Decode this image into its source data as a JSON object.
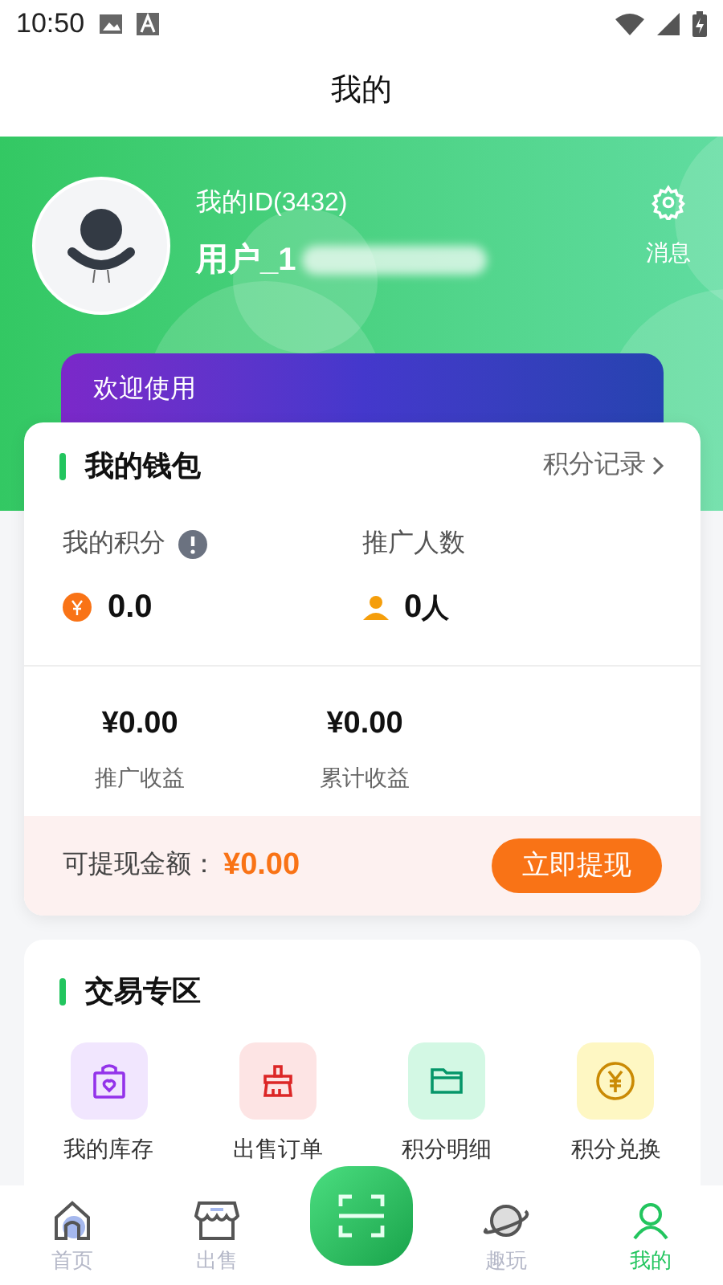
{
  "status_bar": {
    "time": "10:50"
  },
  "header": {
    "title": "我的"
  },
  "profile": {
    "id_label": "我的ID(3432)",
    "username": "用户_1",
    "messages_label": "消息"
  },
  "banner": {
    "text": "欢迎使用"
  },
  "wallet": {
    "title": "我的钱包",
    "link": "积分记录",
    "stats": [
      {
        "kind": "points",
        "label": "我的积分",
        "value": "0.0"
      },
      {
        "kind": "people",
        "label": "推广人数",
        "value": "0",
        "unit": "人"
      }
    ],
    "earnings": [
      {
        "value": "¥0.00",
        "label": "推广收益"
      },
      {
        "value": "¥0.00",
        "label": "累计收益"
      }
    ],
    "withdraw": {
      "label": "可提现金额：",
      "amount": "¥0.00",
      "button": "立即提现"
    }
  },
  "trade": {
    "title": "交易专区",
    "items": [
      {
        "kind": "bag",
        "label": "我的库存"
      },
      {
        "kind": "brush",
        "label": "出售订单"
      },
      {
        "kind": "folder",
        "label": "积分明细"
      },
      {
        "kind": "coin",
        "label": "积分兑换"
      }
    ]
  },
  "nav": [
    {
      "kind": "home",
      "label": "首页",
      "selected": false
    },
    {
      "kind": "shop",
      "label": "出售",
      "selected": false
    },
    {
      "kind": "scan"
    },
    {
      "kind": "planet",
      "label": "趣玩",
      "selected": false
    },
    {
      "kind": "user",
      "label": "我的",
      "selected": true
    }
  ]
}
